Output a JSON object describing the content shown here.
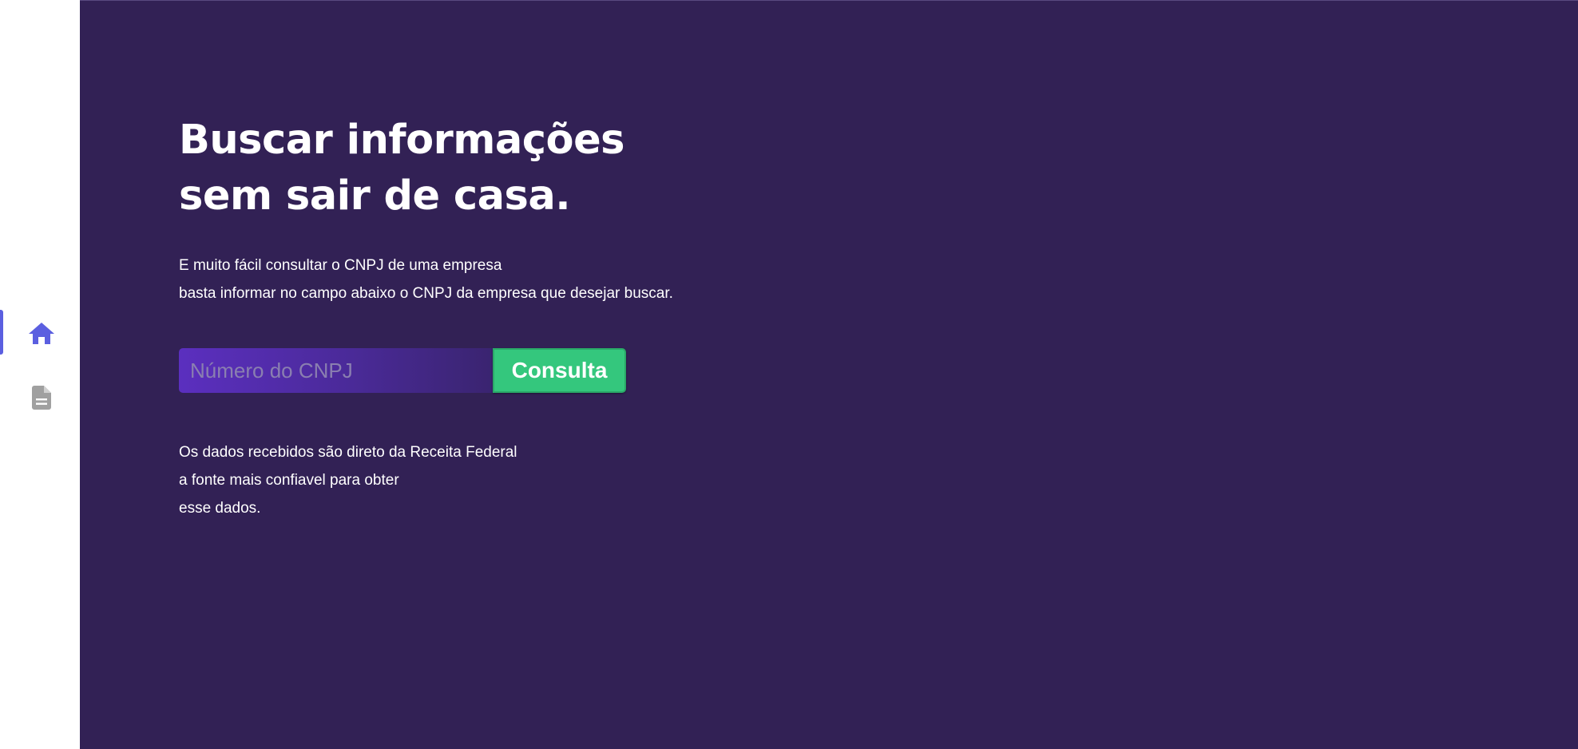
{
  "sidebar": {
    "items": [
      {
        "icon": "home-icon",
        "active": true
      },
      {
        "icon": "document-icon",
        "active": false
      }
    ],
    "colors": {
      "active": "#5b5fe0",
      "inactive": "#9e9e9e"
    }
  },
  "main": {
    "background": "#322155",
    "headline": {
      "line1": "Buscar informações",
      "line2": "sem sair de casa."
    },
    "intro": {
      "line1": "E muito fácil consultar o CNPJ de uma empresa",
      "line2": "basta informar no campo abaixo o CNPJ da empresa que desejar buscar."
    },
    "search": {
      "placeholder": "Número do CNPJ",
      "value": "",
      "button_label": "Consulta",
      "button_color": "#34c77d"
    },
    "footer": {
      "line1": "Os dados recebidos são direto da Receita Federal",
      "line2": "a fonte mais confiavel para obter",
      "line3": "esse dados."
    }
  }
}
